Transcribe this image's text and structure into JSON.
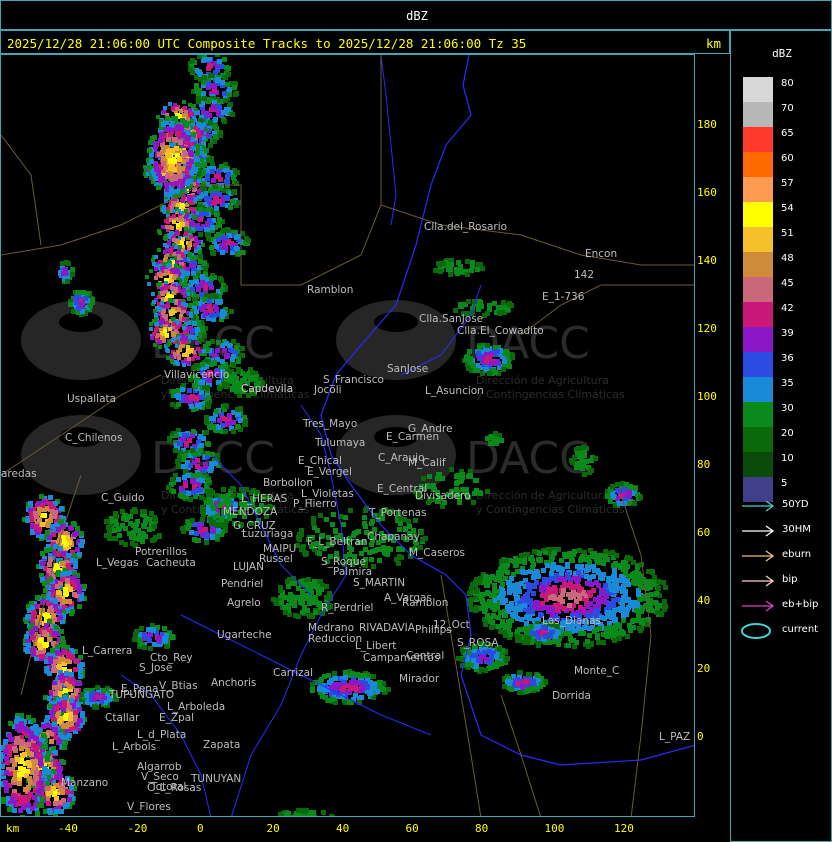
{
  "header": {
    "title": "dBZ"
  },
  "status": {
    "text": "2025/12/28 21:06:00 UTC Composite Tracks to 2025/12/28 21:06:00 Tz 35",
    "unit": "km"
  },
  "axes": {
    "y_ticks": [
      "180",
      "160",
      "140",
      "120",
      "100",
      "80",
      "60",
      "40",
      "20",
      "0"
    ],
    "x_ticks": [
      "-40",
      "-20",
      "0",
      "20",
      "40",
      "60",
      "80",
      "100",
      "120"
    ],
    "x_unit": "km"
  },
  "legend": {
    "title": "dBZ",
    "levels": [
      {
        "label": "80",
        "color": "#d8d8d8"
      },
      {
        "label": "70",
        "color": "#b8b8b8"
      },
      {
        "label": "65",
        "color": "#ff3a2a"
      },
      {
        "label": "60",
        "color": "#ff6a00"
      },
      {
        "label": "57",
        "color": "#ff9a50"
      },
      {
        "label": "54",
        "color": "#ffff00"
      },
      {
        "label": "51",
        "color": "#f6c02a"
      },
      {
        "label": "48",
        "color": "#cf8a3a"
      },
      {
        "label": "45",
        "color": "#c9687a"
      },
      {
        "label": "42",
        "color": "#c9187a"
      },
      {
        "label": "39",
        "color": "#8a18c9"
      },
      {
        "label": "36",
        "color": "#2a4ae0"
      },
      {
        "label": "35",
        "color": "#188ad8"
      },
      {
        "label": "30",
        "color": "#0a8a1a"
      },
      {
        "label": "20",
        "color": "#0a6a0a"
      },
      {
        "label": "10",
        "color": "#0a4a0a"
      },
      {
        "label": "5",
        "color": "#40408a"
      }
    ],
    "tracks": [
      {
        "label": "50YD",
        "color": "#3fd0d0",
        "kind": "arrow"
      },
      {
        "label": "30HM",
        "color": "#ffffff",
        "kind": "arrow"
      },
      {
        "label": "eburn",
        "color": "#f0c080",
        "kind": "arrow"
      },
      {
        "label": "bip",
        "color": "#ffd0d0",
        "kind": "arrow"
      },
      {
        "label": "eb+bip",
        "color": "#e040c0",
        "kind": "arrow"
      },
      {
        "label": "current",
        "color": "#3fd0d0",
        "kind": "ellipse"
      }
    ]
  },
  "places": [
    {
      "name": "Clla.del_Rosario"
    },
    {
      "name": "Encon"
    },
    {
      "name": "142"
    },
    {
      "name": "E_1-736"
    },
    {
      "name": "Ramblon"
    },
    {
      "name": "Clla.SanJose"
    },
    {
      "name": "Clla.El_Cowadito"
    },
    {
      "name": "Villavicencio"
    },
    {
      "name": "Caudevila"
    },
    {
      "name": "S_Francisco"
    },
    {
      "name": "Jocoli"
    },
    {
      "name": "SanJose"
    },
    {
      "name": "L_Asuncion"
    },
    {
      "name": "Uspallata"
    },
    {
      "name": "Tres_Mayo"
    },
    {
      "name": "Tulumaya"
    },
    {
      "name": "E_Carmen"
    },
    {
      "name": "G_Andre"
    },
    {
      "name": "C_Chilenos"
    },
    {
      "name": "E_Chical"
    },
    {
      "name": "C_Araujo"
    },
    {
      "name": "E_Vergel"
    },
    {
      "name": "M_Calif"
    },
    {
      "name": "aredas"
    },
    {
      "name": "Borbollon"
    },
    {
      "name": "L_Violetas"
    },
    {
      "name": "E_Central"
    },
    {
      "name": "Divisadero"
    },
    {
      "name": "C_Guido"
    },
    {
      "name": "L_HERAS"
    },
    {
      "name": "P_Hierro"
    },
    {
      "name": "MENDOZA"
    },
    {
      "name": "T_Portenas"
    },
    {
      "name": "G_CRUZ"
    },
    {
      "name": "Luzuriaga"
    },
    {
      "name": "Chapanay"
    },
    {
      "name": "F_L_Beltran"
    },
    {
      "name": "Potrerillos"
    },
    {
      "name": "MAIPU"
    },
    {
      "name": "Russel"
    },
    {
      "name": "M_Caseros"
    },
    {
      "name": "L_Vegas"
    },
    {
      "name": "Cacheuta"
    },
    {
      "name": "LUJAN"
    },
    {
      "name": "S_Roque"
    },
    {
      "name": "Palmira"
    },
    {
      "name": "Pendriel"
    },
    {
      "name": "S_MARTIN"
    },
    {
      "name": "Agrelo"
    },
    {
      "name": "A_Vargas"
    },
    {
      "name": "Ramblon"
    },
    {
      "name": "R_Perdriel"
    },
    {
      "name": "Ugarteche"
    },
    {
      "name": "Medrano"
    },
    {
      "name": "RIVADAVIA"
    },
    {
      "name": "Phillips"
    },
    {
      "name": "Reduccion"
    },
    {
      "name": "L_Libert"
    },
    {
      "name": "12_Oct"
    },
    {
      "name": "S_ROSA"
    },
    {
      "name": "L_Carrera"
    },
    {
      "name": "Cto_Rey"
    },
    {
      "name": "Campamentos"
    },
    {
      "name": "Central"
    },
    {
      "name": "S_Jose"
    },
    {
      "name": "Carrizal"
    },
    {
      "name": "E_Pena"
    },
    {
      "name": "V_Btias"
    },
    {
      "name": "Anchoris"
    },
    {
      "name": "TUPUNGATO"
    },
    {
      "name": "Mirador"
    },
    {
      "name": "Dorrida"
    },
    {
      "name": "L_Arboleda"
    },
    {
      "name": "Ctallar"
    },
    {
      "name": "E_Zpal"
    },
    {
      "name": "L_d_Plata"
    },
    {
      "name": "Zapata"
    },
    {
      "name": "L_Arbols"
    },
    {
      "name": "Algarrob"
    },
    {
      "name": "V_Seco"
    },
    {
      "name": "Totoral"
    },
    {
      "name": "TUNUYAN"
    },
    {
      "name": "Manzano"
    },
    {
      "name": "C_L_Rosas"
    },
    {
      "name": "V_Flores"
    },
    {
      "name": "Las_Dianas"
    },
    {
      "name": "Monte_C"
    },
    {
      "name": "L_PAZ"
    },
    {
      "name": "Capdevila"
    }
  ],
  "watermark": {
    "logo": "DACC",
    "line1": "Dirección de Agricultura",
    "line2": "y Contingencias Climáticas"
  }
}
